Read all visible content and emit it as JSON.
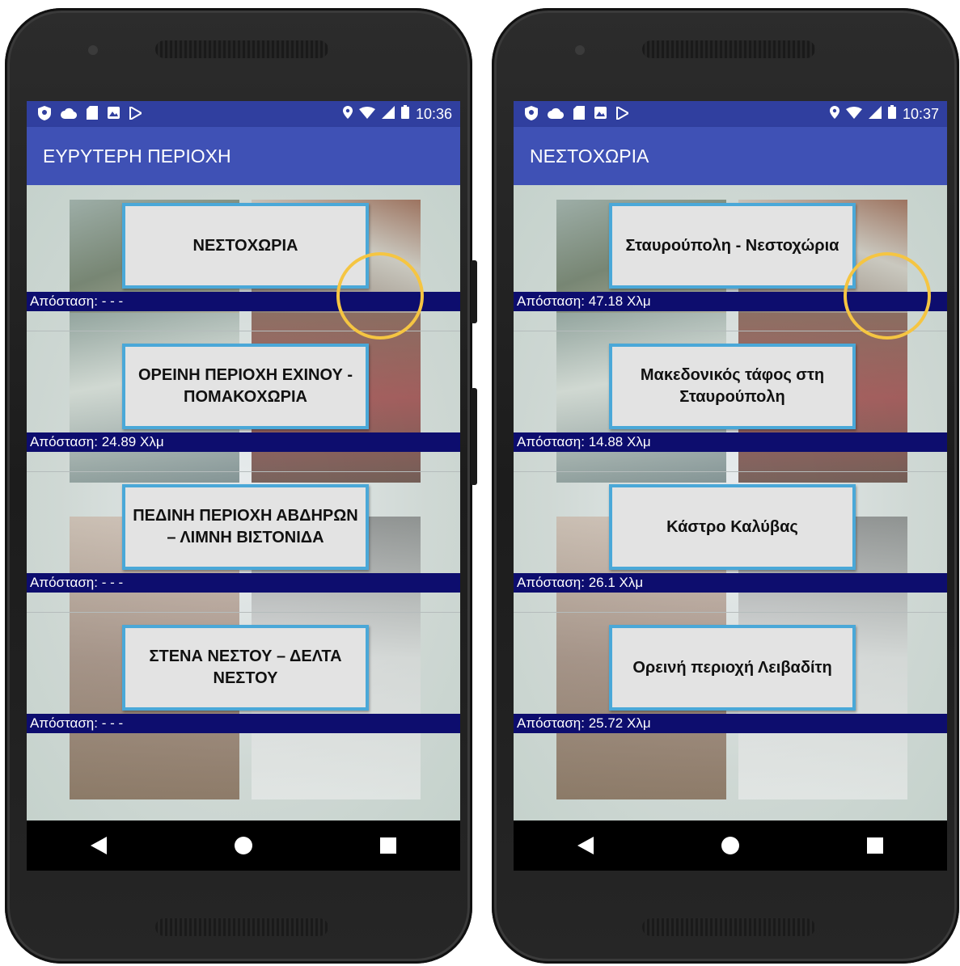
{
  "phones": [
    {
      "status_time": "10:36",
      "app_title": "ΕΥΡΥΤΕΡΗ ΠΕΡΙΟΧΗ",
      "items": [
        {
          "label": "ΝΕΣΤΟΧΩΡΙΑ",
          "distance": "Απόσταση: - - -"
        },
        {
          "label": "ΟΡΕΙΝΗ ΠΕΡΙΟΧΗ ΕΧΙΝΟΥ - ΠΟΜΑΚΟΧΩΡΙΑ",
          "distance": "Απόσταση: 24.89 Χλμ"
        },
        {
          "label": "ΠΕΔΙΝΗ ΠΕΡΙΟΧΗ ΑΒΔΗΡΩΝ – ΛΙΜΝΗ ΒΙΣΤΟΝΙΔΑ",
          "distance": "Απόσταση: - - -"
        },
        {
          "label": "ΣΤΕΝΑ ΝΕΣΤΟΥ – ΔΕΛΤΑ ΝΕΣΤΟΥ",
          "distance": "Απόσταση: - - -"
        }
      ]
    },
    {
      "status_time": "10:37",
      "app_title": "ΝΕΣΤΟΧΩΡΙΑ",
      "items": [
        {
          "label": "Σταυρούπολη - Νεστοχώρια",
          "distance": "Απόσταση: 47.18 Χλμ"
        },
        {
          "label": "Μακεδονικός τάφος στη Σταυρούπολη",
          "distance": "Απόσταση: 14.88 Χλμ"
        },
        {
          "label": "Κάστρο Καλύβας",
          "distance": "Απόσταση: 26.1 Χλμ"
        },
        {
          "label": "Ορεινή περιοχή Λειβαδίτη",
          "distance": "Απόσταση: 25.72 Χλμ"
        }
      ]
    }
  ],
  "icons": {
    "status_left": [
      "shield-icon",
      "cloud-icon",
      "sd-card-icon",
      "photo-icon",
      "play-store-icon"
    ],
    "status_right": [
      "location-icon",
      "wifi-icon",
      "signal-icon",
      "battery-icon"
    ],
    "nav": [
      "back-icon",
      "home-icon",
      "recents-icon"
    ]
  },
  "colors": {
    "statusbar": "#303f9f",
    "appbar": "#3f51b5",
    "distance_bar": "#0d0d6e",
    "button_border": "#4aa8d8",
    "highlight_ring": "#f5c542"
  }
}
